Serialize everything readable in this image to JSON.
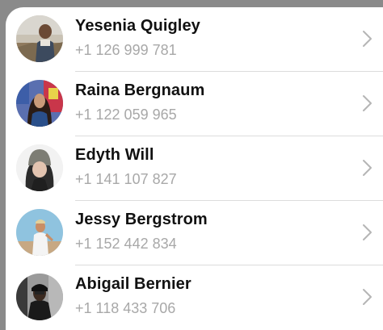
{
  "contacts": [
    {
      "name": "Yesenia Quigley",
      "phone": "+1 126 999 781",
      "avatar_icon": "avatar-photo-icon"
    },
    {
      "name": "Raina Bergnaum",
      "phone": "+1 122 059 965",
      "avatar_icon": "avatar-photo-icon"
    },
    {
      "name": "Edyth Will",
      "phone": "+1 141 107 827",
      "avatar_icon": "avatar-photo-icon"
    },
    {
      "name": "Jessy Bergstrom",
      "phone": "+1 152 442 834",
      "avatar_icon": "avatar-photo-icon"
    },
    {
      "name": "Abigail Bernier",
      "phone": "+1 118 433 706",
      "avatar_icon": "avatar-photo-icon"
    }
  ],
  "row_action_icon": "chevron-right-icon",
  "colors": {
    "backdrop": "#8a8a8a",
    "card": "#ffffff",
    "name_text": "#111111",
    "phone_text": "#a8a8a8",
    "chevron": "#b5b5b5",
    "divider": "#dcdcdc"
  }
}
